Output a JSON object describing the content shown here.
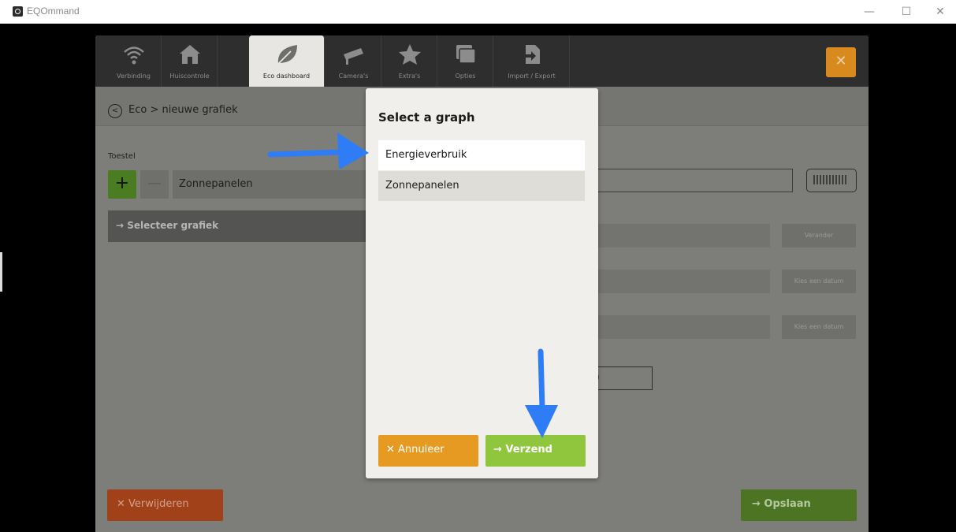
{
  "window": {
    "title": "EQOmmand",
    "minimize": "—",
    "maximize": "☐",
    "close": "✕"
  },
  "tabs": [
    {
      "label": "Verbinding",
      "icon": "wifi-icon"
    },
    {
      "label": "Huiscontrole",
      "icon": "home-icon"
    },
    {
      "label": "Eco dashboard",
      "icon": "leaf-icon",
      "active": true
    },
    {
      "label": "Camera's",
      "icon": "camera-icon"
    },
    {
      "label": "Extra's",
      "icon": "star-icon"
    },
    {
      "label": "Opties",
      "icon": "windows-icon"
    },
    {
      "label": "Import / Export",
      "icon": "import-export-icon"
    }
  ],
  "header": {
    "close_symbol": "✕",
    "back_symbol": "<",
    "breadcrumb": "Eco  >  nieuwe grafiek"
  },
  "form": {
    "toestel_label": "Toestel",
    "plus": "+",
    "minus": "—",
    "device_value": "Zonnepanelen",
    "select_chart": "→  Selecteer grafiek",
    "verander": "Verander",
    "date_btn_1": "Kies een datum",
    "date_btn_2": "Kies een datum",
    "number_partial": "0"
  },
  "footer": {
    "delete_label": "✕  Verwijderen",
    "save_label": "→  Opslaan"
  },
  "modal": {
    "title": "Select a graph",
    "options": [
      "Energieverbruik",
      "Zonnepanelen"
    ],
    "selected_index": 0,
    "cancel_label": "✕  Annuleer",
    "send_label": "→  Verzend"
  },
  "colors": {
    "accent_orange": "#e69a22",
    "accent_green": "#8fc63d",
    "annotation_blue": "#2f7df6"
  }
}
